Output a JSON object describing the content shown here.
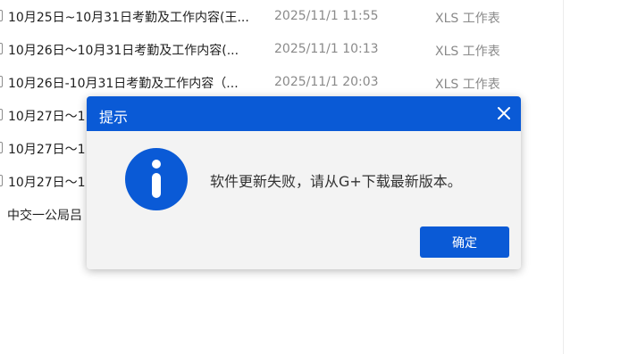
{
  "file_list": [
    {
      "name": "10月25日~10月31日考勤及工作内容(王...",
      "date": "2025/11/1 11:55",
      "type": "XLS 工作表"
    },
    {
      "name": "10月26日～10月31日考勤及工作内容(...",
      "date": "2025/11/1 10:13",
      "type": "XLS 工作表"
    },
    {
      "name": "10月26日-10月31日考勤及工作内容（...",
      "date": "2025/11/1 20:03",
      "type": "XLS 工作表"
    },
    {
      "name": "10月27日～1",
      "date": "",
      "type": ""
    },
    {
      "name": "10月27日～1",
      "date": "",
      "type": ""
    },
    {
      "name": "10月27日～1",
      "date": "",
      "type": ""
    },
    {
      "name": "中交一公局吕",
      "date": "",
      "type": ""
    }
  ],
  "dialog": {
    "title": "提示",
    "message": "软件更新失败，请从G+下载最新版本。",
    "ok_label": "确定",
    "accent_color": "#0a5ad6",
    "icon": "info-icon",
    "close_icon": "close-icon"
  }
}
